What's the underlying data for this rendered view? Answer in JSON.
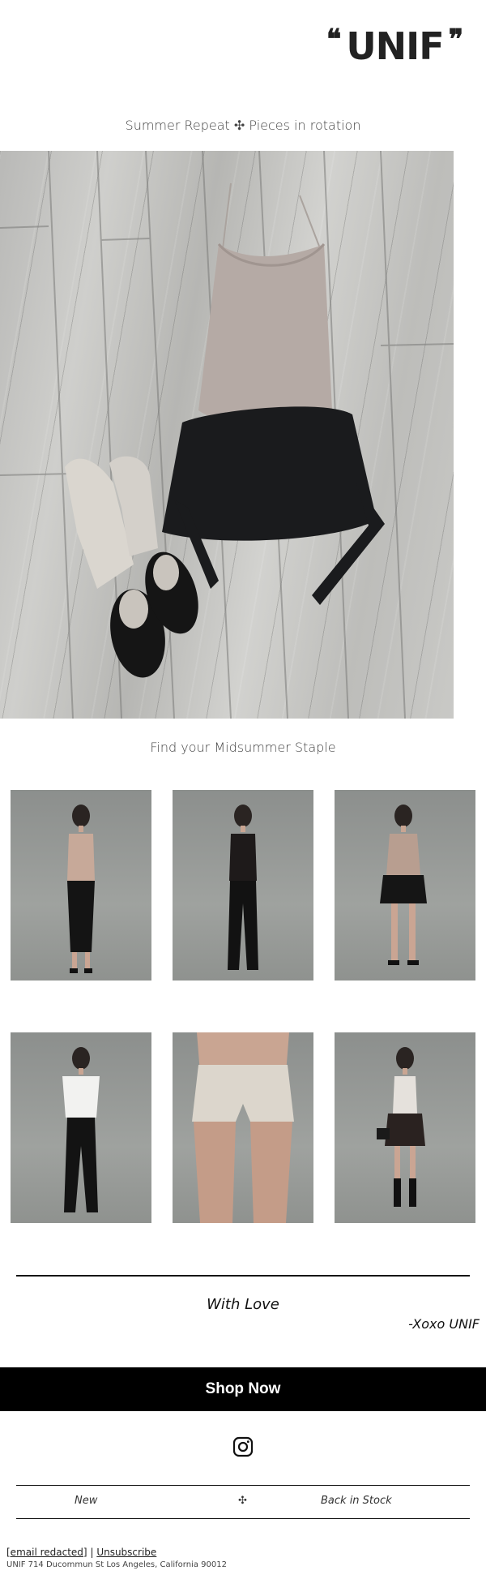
{
  "header": {
    "logo_text": "UNIF",
    "quote_open": "❝",
    "quote_close": "❞"
  },
  "hero": {
    "tagline": "Summer Repeat ✣ Pieces in rotation",
    "image_icon": "outfit-flatlay-photo"
  },
  "products": {
    "heading": "Find your Midsummer Staple",
    "items": [
      {
        "icon": "model-photo"
      },
      {
        "icon": "model-photo"
      },
      {
        "icon": "model-photo"
      },
      {
        "icon": "model-photo"
      },
      {
        "icon": "shorts-photo"
      },
      {
        "icon": "model-photo"
      }
    ]
  },
  "closing": {
    "with_love": "With Love",
    "signature": "-Xoxo UNIF"
  },
  "cta": {
    "shop_label": "Shop Now"
  },
  "social": {
    "icon": "instagram-icon"
  },
  "nav": {
    "new_label": "New",
    "separator": "✣",
    "back_label": "Back in Stock"
  },
  "footer": {
    "email": "[email redacted]",
    "divider": "|",
    "unsubscribe": "Unsubscribe",
    "address": "UNIF 714 Ducommun St Los Angeles, California 90012"
  },
  "colors": {
    "black": "#000000",
    "white": "#ffffff",
    "grey_backdrop": "#9a9d9a"
  }
}
